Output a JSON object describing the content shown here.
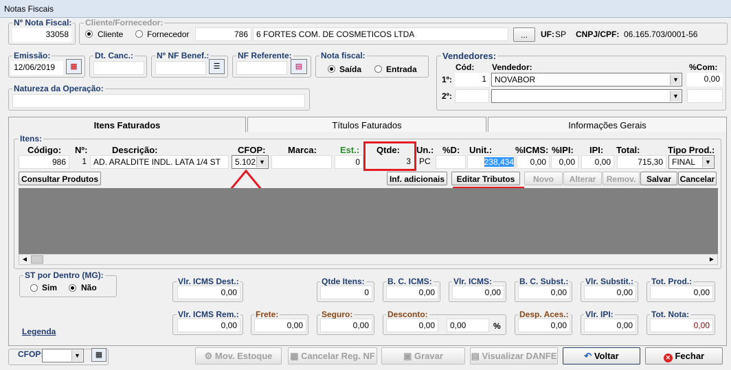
{
  "window": {
    "title": "Notas Fiscais"
  },
  "header": {
    "nf_label": "Nº Nota Fiscal:",
    "nf_value": "33058",
    "cliente_label": "Cliente/Fornecedor:",
    "opt_cliente": "Cliente",
    "opt_fornecedor": "Fornecedor",
    "cliente_code": "786",
    "cliente_name": "6 FORTES COM. DE COSMETICOS LTDA",
    "browse_btn": "...",
    "uf_label": "UF:",
    "uf_value": "SP",
    "cnpj_label": "CNPJ/CPF:",
    "cnpj_value": "06.165.703/0001-56",
    "emissao_label": "Emissão:",
    "emissao_value": "12/06/2019",
    "dtcanc_label": "Dt. Canc.:",
    "nfbenef_label": "Nº NF Benef.:",
    "nfref_label": "NF Referente:",
    "notafiscal_label": "Nota fiscal:",
    "opt_saida": "Saída",
    "opt_entrada": "Entrada",
    "natureza_label": "Natureza da Operação:"
  },
  "vendedores": {
    "label": "Vendedores:",
    "cod_label": "Cód:",
    "vend_label": "Vendedor:",
    "com_label": "%Com:",
    "row1_label": "1º:",
    "row1_cod": "1",
    "row1_name": "NOVABOR",
    "row1_com": "0,00",
    "row2_label": "2º:"
  },
  "tabs": [
    "Itens Faturados",
    "Títulos Faturados",
    "Informações Gerais"
  ],
  "itens": {
    "label": "Itens:",
    "headers": {
      "codigo": "Código:",
      "n": "Nº:",
      "descricao": "Descrição:",
      "cfop": "CFOP:",
      "marca": "Marca:",
      "est": "Est.:",
      "qtde": "Qtde:",
      "un": "Un.:",
      "pd": "%D:",
      "unit": "Unit.:",
      "icms": "%ICMS:",
      "ipi_p": "%IPI:",
      "ipi": "IPI:",
      "total": "Total:",
      "tipo": "Tipo Prod.:"
    },
    "row": {
      "codigo": "986",
      "n": "1",
      "descricao": "AD. ARALDITE INDL. LATA 1/4 ST",
      "cfop": "5.102",
      "est": "0",
      "qtde": "3",
      "un": "PC",
      "unit": "238,434",
      "icms": "0,00",
      "ipi_p": "0,00",
      "ipi": "0,00",
      "total": "715,30",
      "tipo": "FINAL"
    },
    "buttons": {
      "consultar": "Consultar Produtos",
      "inf": "Inf. adicionais",
      "editar": "Editar Tributos",
      "novo": "Novo",
      "alterar": "Alterar",
      "remov": "Remov.",
      "salvar": "Salvar",
      "cancelar": "Cancelar"
    }
  },
  "st": {
    "label": "ST por Dentro (MG):",
    "sim": "Sim",
    "nao": "Não"
  },
  "legenda": "Legenda",
  "totais": {
    "vicms_dest_l": "Vlr. ICMS Dest.:",
    "vicms_dest": "0,00",
    "qtde_itens_l": "Qtde Itens:",
    "qtde_itens": "0",
    "bc_icms_l": "B. C. ICMS:",
    "bc_icms": "0,00",
    "vicms_l": "Vlr. ICMS:",
    "vicms": "0,00",
    "bc_subst_l": "B. C. Subst.:",
    "bc_subst": "0,00",
    "vsubst_l": "Vlr. Substit.:",
    "vsubst": "0,00",
    "tot_prod_l": "Tot. Prod.:",
    "tot_prod": "0,00",
    "vicms_rem_l": "Vlr. ICMS Rem.:",
    "vicms_rem": "0,00",
    "frete_l": "Frete:",
    "frete": "0,00",
    "seguro_l": "Seguro:",
    "seguro": "0,00",
    "desconto_l": "Desconto:",
    "desconto": "0,00",
    "desconto_pct": "0,00",
    "pct": "%",
    "desp_l": "Desp. Aces.:",
    "desp": "0,00",
    "vipi_l": "Vlr. IPI:",
    "vipi": "0,00",
    "tot_nota_l": "Tot. Nota:",
    "tot_nota": "0,00"
  },
  "footer": {
    "cfop_label": "CFOP:",
    "mov": "Mov. Estoque",
    "cancelar_reg": "Cancelar Reg. NF",
    "gravar": "Gravar",
    "visualizar": "Visualizar DANFE",
    "voltar": "Voltar",
    "fechar": "Fechar"
  },
  "colors": {
    "accent": "#1f3d70",
    "highlight": "#e31b23",
    "selection": "#3399ff"
  }
}
